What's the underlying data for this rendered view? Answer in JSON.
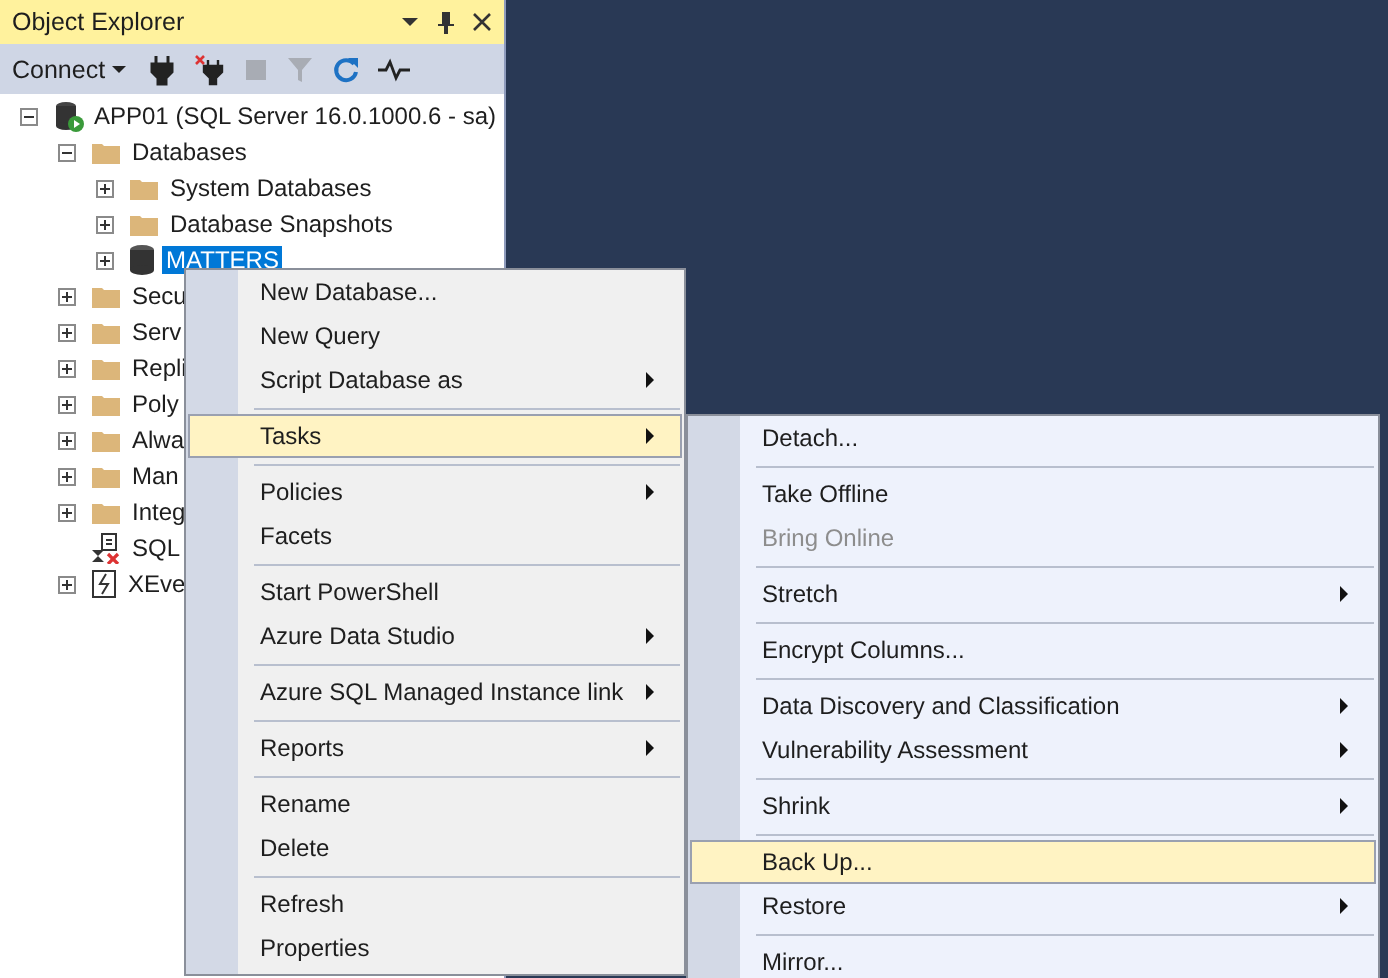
{
  "panel": {
    "title": "Object Explorer"
  },
  "toolbar": {
    "connect": "Connect",
    "stop_disabled": true,
    "filter_disabled": true
  },
  "tree": [
    {
      "label": "APP01 (SQL Server 16.0.1000.6 - sa)",
      "kind": "server",
      "expanded": true,
      "selected": false,
      "children": [
        {
          "label": "Databases",
          "kind": "folder",
          "expanded": true,
          "selected": false,
          "children": [
            {
              "label": "System Databases",
              "kind": "folder",
              "expanded": false,
              "selected": false
            },
            {
              "label": "Database Snapshots",
              "kind": "folder",
              "expanded": false,
              "selected": false
            },
            {
              "label": "MATTERS",
              "kind": "database",
              "expanded": false,
              "selected": true
            }
          ]
        },
        {
          "label": "Secu",
          "kind": "folder",
          "expanded": false,
          "selected": false
        },
        {
          "label": "Serv",
          "kind": "folder",
          "expanded": false,
          "selected": false
        },
        {
          "label": "Repli",
          "kind": "folder",
          "expanded": false,
          "selected": false
        },
        {
          "label": "Poly",
          "kind": "folder",
          "expanded": false,
          "selected": false
        },
        {
          "label": "Alwa",
          "kind": "folder",
          "expanded": false,
          "selected": false
        },
        {
          "label": "Man",
          "kind": "folder",
          "expanded": false,
          "selected": false
        },
        {
          "label": "Integ",
          "kind": "folder",
          "expanded": false,
          "selected": false
        },
        {
          "label": "SQL",
          "kind": "agent",
          "selected": false
        },
        {
          "label": "XEve",
          "kind": "xevent",
          "expanded": false,
          "selected": false
        }
      ]
    }
  ],
  "context_menu": {
    "groups": [
      [
        {
          "label": "New Database...",
          "submenu": false,
          "selected": false,
          "disabled": false
        },
        {
          "label": "New Query",
          "submenu": false,
          "selected": false,
          "disabled": false
        },
        {
          "label": "Script Database as",
          "submenu": true,
          "selected": false,
          "disabled": false
        }
      ],
      [
        {
          "label": "Tasks",
          "submenu": true,
          "selected": true,
          "disabled": false
        }
      ],
      [
        {
          "label": "Policies",
          "submenu": true,
          "selected": false,
          "disabled": false
        },
        {
          "label": "Facets",
          "submenu": false,
          "selected": false,
          "disabled": false
        }
      ],
      [
        {
          "label": "Start PowerShell",
          "submenu": false,
          "selected": false,
          "disabled": false
        },
        {
          "label": "Azure Data Studio",
          "submenu": true,
          "selected": false,
          "disabled": false
        }
      ],
      [
        {
          "label": "Azure SQL Managed Instance link",
          "submenu": true,
          "selected": false,
          "disabled": false
        }
      ],
      [
        {
          "label": "Reports",
          "submenu": true,
          "selected": false,
          "disabled": false
        }
      ],
      [
        {
          "label": "Rename",
          "submenu": false,
          "selected": false,
          "disabled": false
        },
        {
          "label": "Delete",
          "submenu": false,
          "selected": false,
          "disabled": false
        }
      ],
      [
        {
          "label": "Refresh",
          "submenu": false,
          "selected": false,
          "disabled": false
        },
        {
          "label": "Properties",
          "submenu": false,
          "selected": false,
          "disabled": false
        }
      ]
    ]
  },
  "tasks_menu": {
    "groups": [
      [
        {
          "label": "Detach...",
          "submenu": false,
          "selected": false,
          "disabled": false
        }
      ],
      [
        {
          "label": "Take Offline",
          "submenu": false,
          "selected": false,
          "disabled": false
        },
        {
          "label": "Bring Online",
          "submenu": false,
          "selected": false,
          "disabled": true
        }
      ],
      [
        {
          "label": "Stretch",
          "submenu": true,
          "selected": false,
          "disabled": false
        }
      ],
      [
        {
          "label": "Encrypt Columns...",
          "submenu": false,
          "selected": false,
          "disabled": false
        }
      ],
      [
        {
          "label": "Data Discovery and Classification",
          "submenu": true,
          "selected": false,
          "disabled": false
        },
        {
          "label": "Vulnerability Assessment",
          "submenu": true,
          "selected": false,
          "disabled": false
        }
      ],
      [
        {
          "label": "Shrink",
          "submenu": true,
          "selected": false,
          "disabled": false
        }
      ],
      [
        {
          "label": "Back Up...",
          "submenu": false,
          "selected": true,
          "disabled": false
        },
        {
          "label": "Restore",
          "submenu": true,
          "selected": false,
          "disabled": false
        }
      ],
      [
        {
          "label": "Mirror...",
          "submenu": false,
          "selected": false,
          "disabled": false
        }
      ]
    ]
  }
}
